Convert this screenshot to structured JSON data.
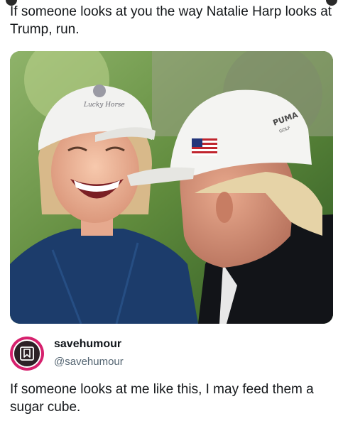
{
  "post": {
    "text": "If someone looks at you the way Natalie Harp looks at Trump, run."
  },
  "photo": {
    "description_icon": "photo-image",
    "cap_left_logo_text": "",
    "cap_right_brand": "PUMA",
    "cap_right_sub": "GOLF"
  },
  "quoted_post": {
    "display_name": "savehumour",
    "handle": "@savehumour",
    "text": "If someone looks at me like this, I may feed them a sugar cube.",
    "avatar_icon": "bookmark-icon",
    "avatar_ring_color": "#d6206d",
    "avatar_bg_color": "#2d2126"
  }
}
